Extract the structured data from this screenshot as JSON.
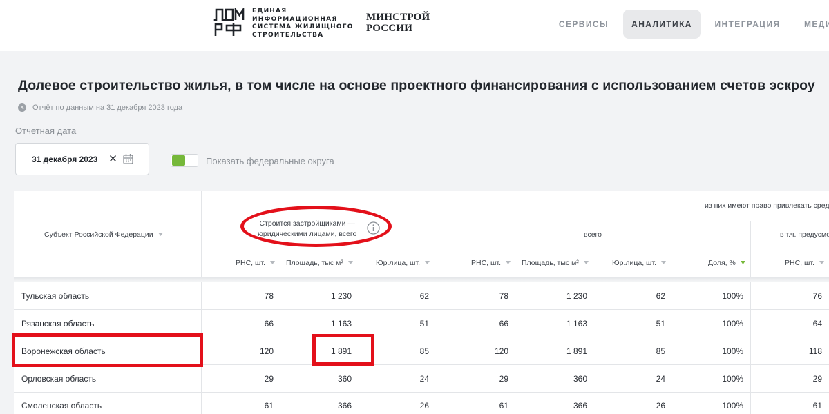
{
  "header": {
    "logo_mark": "ДОМ РФ",
    "logo_text": [
      "ЕДИНАЯ",
      "ИНФОРМАЦИОННАЯ",
      "СИСТЕМА ЖИЛИЩНОГО",
      "СТРОИТЕЛЬСТВА"
    ],
    "ministry": [
      "МИНСТРОЙ",
      "РОССИИ"
    ],
    "nav": [
      {
        "label": "СЕРВИСЫ",
        "active": false
      },
      {
        "label": "АНАЛИТИКА",
        "active": true
      },
      {
        "label": "ИНТЕГРАЦИЯ",
        "active": false
      },
      {
        "label": "МЕДИ",
        "active": false
      }
    ]
  },
  "page": {
    "title": "Долевое строительство жилья, в том числе на основе проектного финансирования с использованием счетов эскроу",
    "report_note": "Отчёт по данным на 31 декабря 2023 года",
    "date_label": "Отчетная дата",
    "date_value": "31 декабря 2023",
    "toggle_label": "Показать федеральные округа",
    "toggle_on": true
  },
  "table": {
    "header": {
      "subject": "Субъект Российской Федерации",
      "group_builders": [
        "Строится застройщиками —",
        "юридическими лицами, всего"
      ],
      "group_escrow": "из них имеют право привлекать сред",
      "sub_total": "всего",
      "sub_incl": "в т.ч. предусмо",
      "columns": [
        "РНС, шт.",
        "Площадь, тыс м²",
        "Юр.лица, шт.",
        "РНС, шт.",
        "Площадь, тыс м²",
        "Юр.лица, шт.",
        "Доля, %",
        "РНС, шт."
      ]
    },
    "rows": [
      {
        "name": "Тульская область",
        "values": [
          "78",
          "1 230",
          "62",
          "78",
          "1 230",
          "62",
          "100%",
          "76"
        ]
      },
      {
        "name": "Рязанская область",
        "values": [
          "66",
          "1 163",
          "51",
          "66",
          "1 163",
          "51",
          "100%",
          "64"
        ]
      },
      {
        "name": "Воронежская область",
        "values": [
          "120",
          "1 891",
          "85",
          "120",
          "1 891",
          "85",
          "100%",
          "118"
        ]
      },
      {
        "name": "Орловская область",
        "values": [
          "29",
          "360",
          "24",
          "29",
          "360",
          "24",
          "100%",
          "29"
        ]
      },
      {
        "name": "Смоленская область",
        "values": [
          "61",
          "366",
          "26",
          "61",
          "366",
          "26",
          "100%",
          "61"
        ]
      }
    ]
  },
  "colors": {
    "annotation": "#e3101a",
    "toggle_accent": "#76b83a",
    "active_sort": "#76b83a"
  }
}
